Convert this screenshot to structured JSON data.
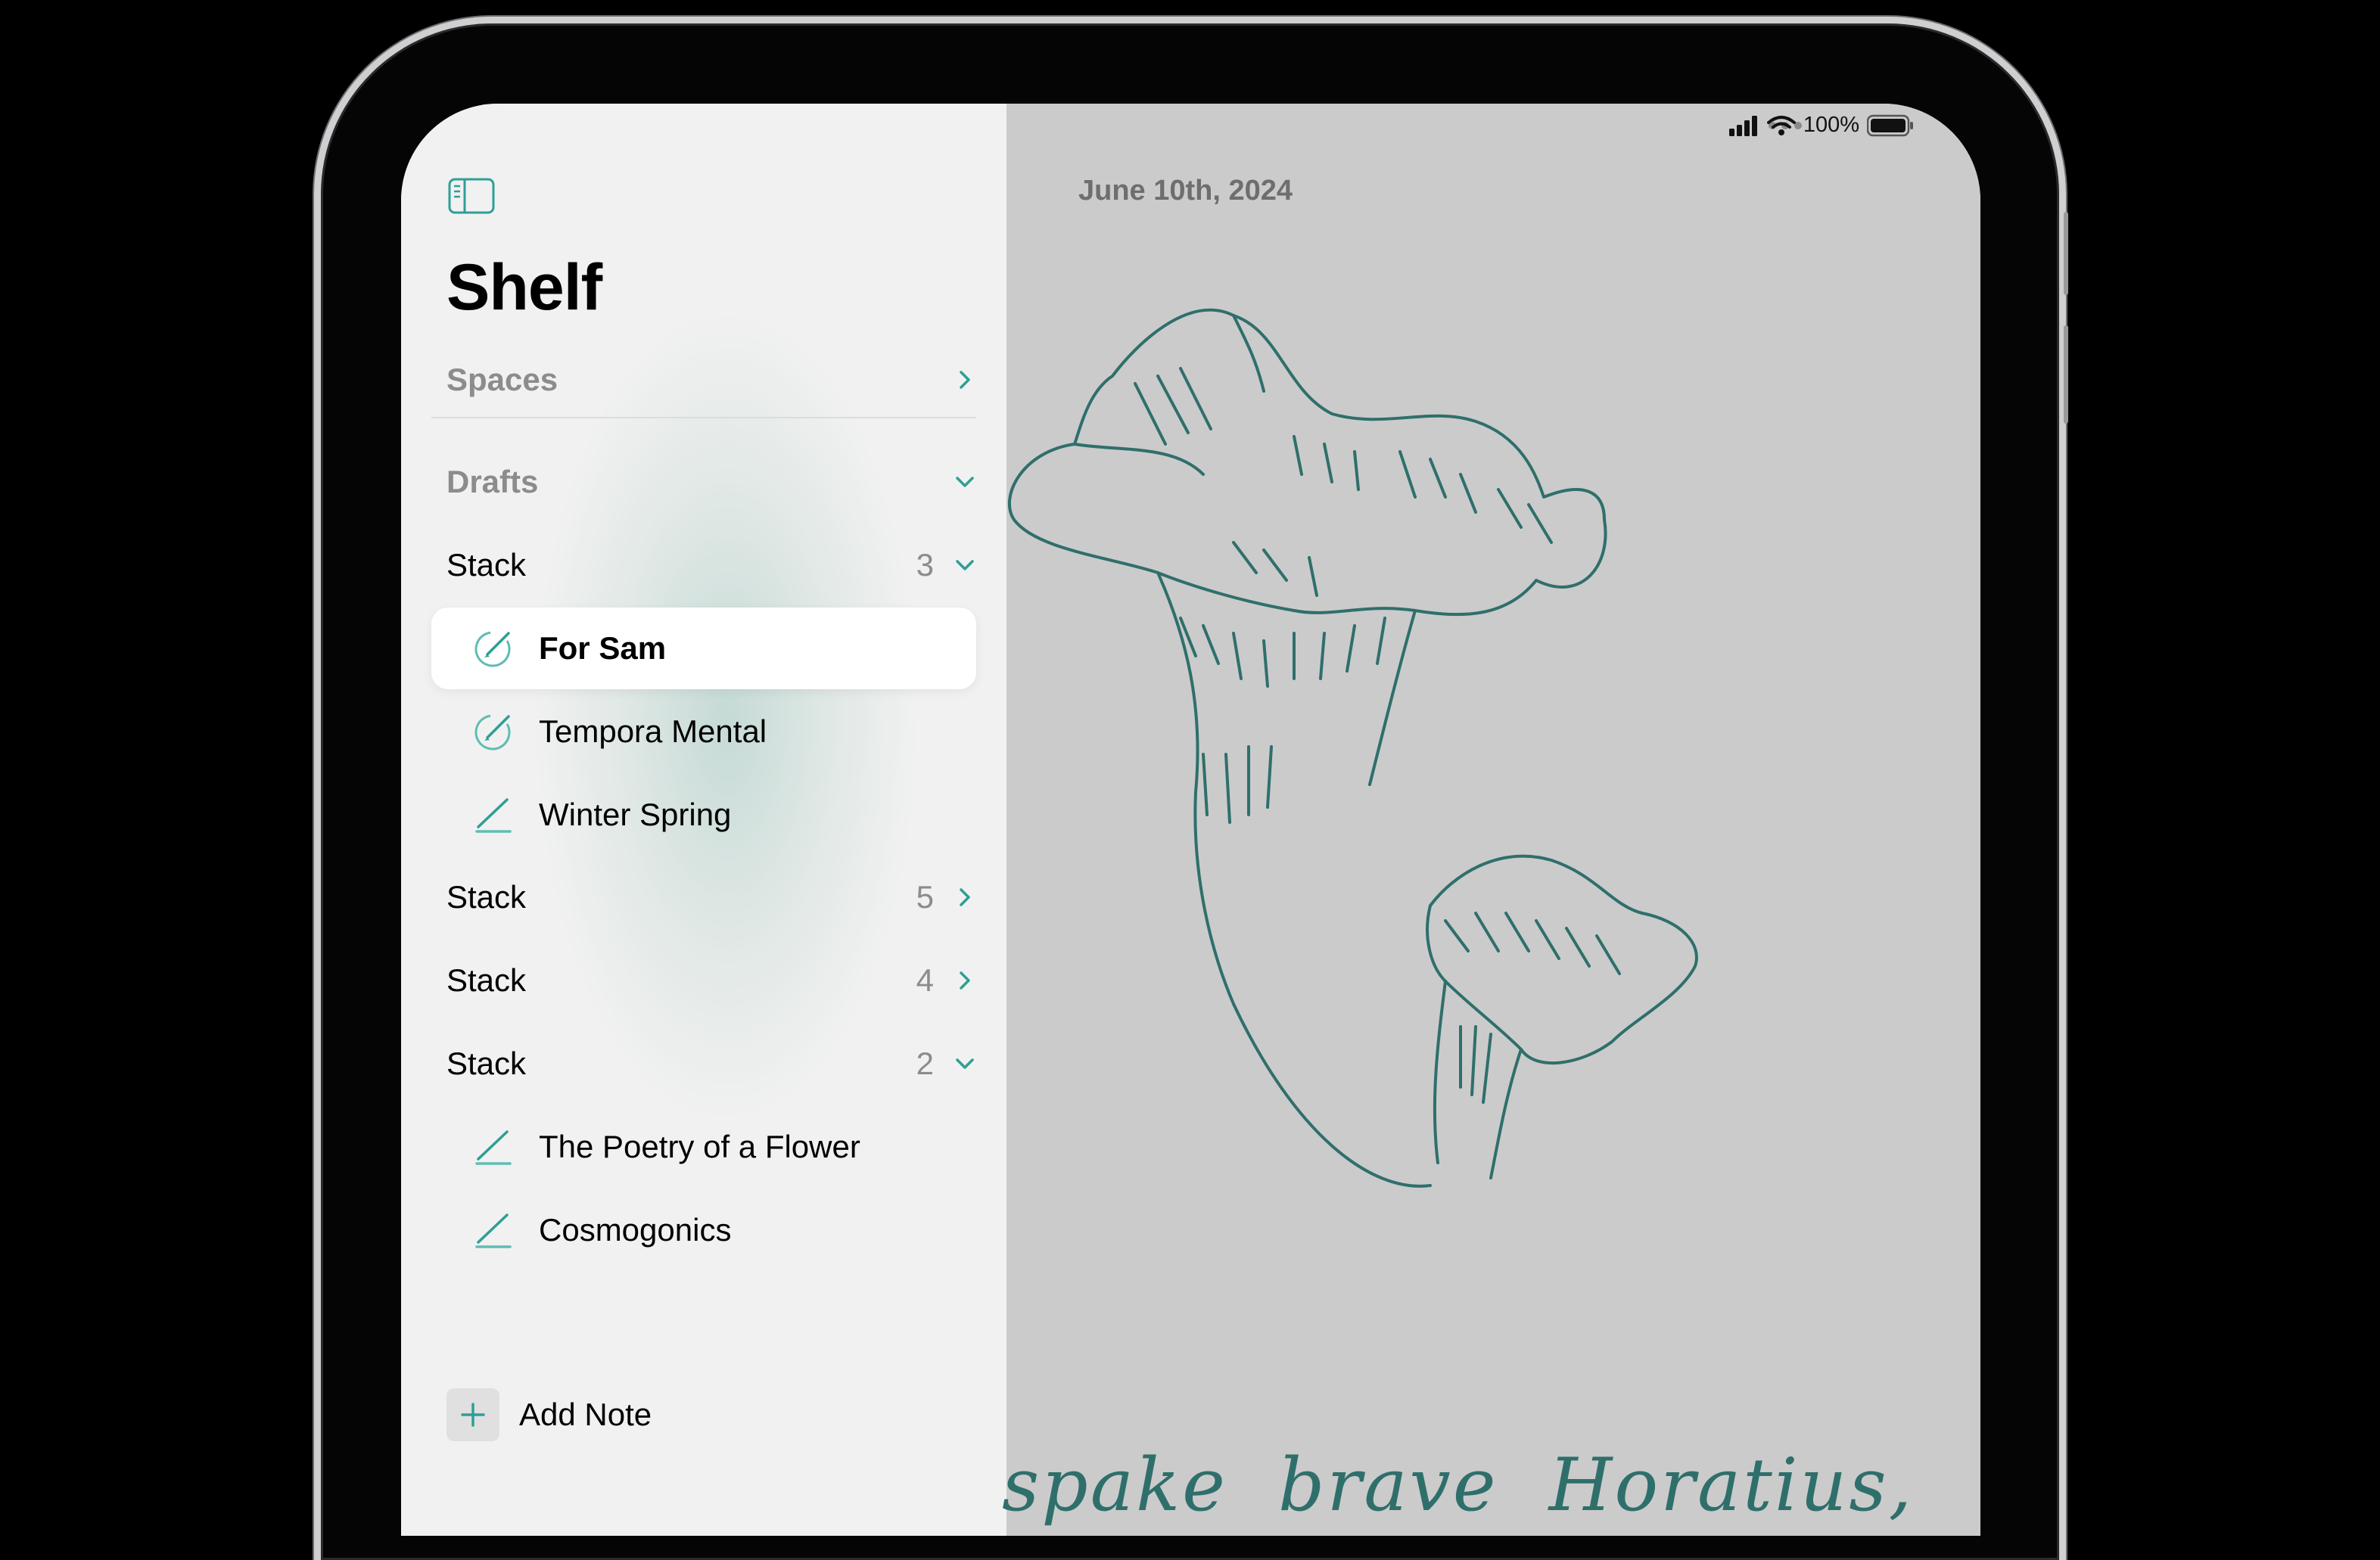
{
  "app": {
    "name": "Shelf"
  },
  "status_bar": {
    "battery": "100%"
  },
  "sidebar": {
    "title": "Shelf",
    "spaces_label": "Spaces",
    "drafts_label": "Drafts",
    "stacks": [
      {
        "label": "Stack",
        "count": "3",
        "expanded": true,
        "notes": [
          {
            "title": "For Sam",
            "icon": "compass-pencil-icon",
            "selected": true
          },
          {
            "title": "Tempora Mental",
            "icon": "compass-pencil-icon",
            "selected": false
          },
          {
            "title": "Winter Spring",
            "icon": "pencil-stroke-icon",
            "selected": false
          }
        ]
      },
      {
        "label": "Stack",
        "count": "5",
        "expanded": false
      },
      {
        "label": "Stack",
        "count": "4",
        "expanded": false
      },
      {
        "label": "Stack",
        "count": "2",
        "expanded": true,
        "notes": [
          {
            "title": "The Poetry of a Flower",
            "icon": "pencil-stroke-icon"
          },
          {
            "title": "Cosmogonics",
            "icon": "pencil-stroke-icon"
          }
        ]
      }
    ],
    "add_note_label": "Add Note"
  },
  "canvas": {
    "date": "June 10th, 2024",
    "handwriting": "spake  brave  Horatius,"
  },
  "colors": {
    "accent": "#2e9f95",
    "ink": "#2f6f6b"
  }
}
